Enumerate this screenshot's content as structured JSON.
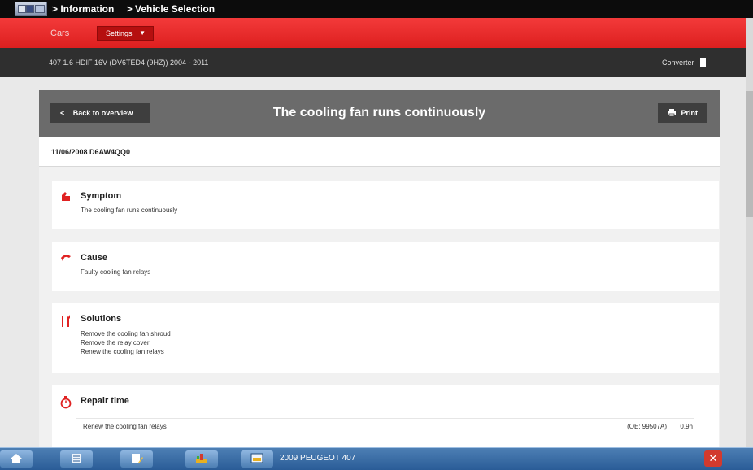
{
  "nav": {
    "breadcrumb": [
      "> Information",
      "> Vehicle Selection"
    ]
  },
  "header": {
    "section_label": "Cars",
    "settings_label": "Settings"
  },
  "vehicle": {
    "description": "407 1.6 HDIF 16V (DV6TED4 (9HZ)) 2004 - 2011",
    "converter_label": "Converter"
  },
  "article": {
    "back_label": "Back to overview",
    "title": "The cooling fan runs continuously",
    "print_label": "Print",
    "date_code": "11/06/2008 D6AW4QQ0"
  },
  "sections": {
    "symptom": {
      "title": "Symptom",
      "text": "The cooling fan runs continuously"
    },
    "cause": {
      "title": "Cause",
      "text": "Faulty cooling fan relays"
    },
    "solutions": {
      "title": "Solutions",
      "steps": [
        "Remove the cooling fan shroud",
        "Remove the relay cover",
        "Renew the cooling fan relays"
      ]
    },
    "repair_time": {
      "title": "Repair time",
      "task": "Renew the cooling fan relays",
      "oe_code": "(OE: 99507A)",
      "hours": "0.9h"
    }
  },
  "taskbar": {
    "label": "2009 PEUGEOT 407"
  },
  "colors": {
    "brand_red": "#e02222",
    "dark_bar": "#2f2f2f",
    "card_header": "#6b6b6b",
    "taskbar_blue": "#2a5c97"
  },
  "icons": {
    "symptom": "alert-icon",
    "cause": "cause-icon",
    "solutions": "tools-icon",
    "repair_time": "stopwatch-icon"
  }
}
